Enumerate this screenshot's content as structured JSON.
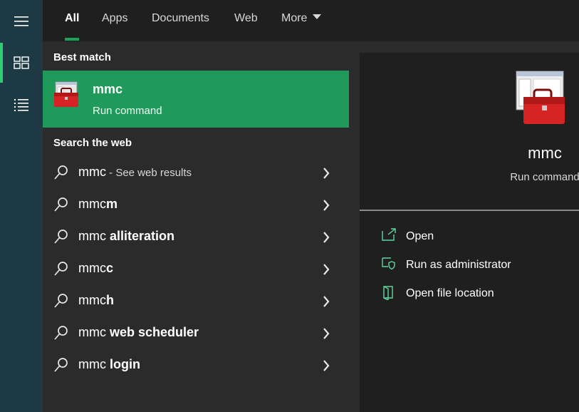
{
  "rail": {
    "items": [
      {
        "icon": "hamburger-icon"
      },
      {
        "icon": "home-tiles-icon",
        "active": true
      },
      {
        "icon": "list-icon"
      }
    ]
  },
  "tabs": [
    {
      "label": "All",
      "active": true
    },
    {
      "label": "Apps"
    },
    {
      "label": "Documents"
    },
    {
      "label": "Web"
    },
    {
      "label": "More"
    }
  ],
  "results": {
    "best_match_title": "Best match",
    "best": {
      "name": "mmc",
      "type": "Run command",
      "icon": "toolbox-icon"
    },
    "web_title": "Search the web",
    "web_items": [
      {
        "prefix": "mmc",
        "bold": "",
        "hint": " - See web results"
      },
      {
        "prefix": "mmc",
        "bold": "m",
        "hint": ""
      },
      {
        "prefix": "mmc ",
        "bold": "alliteration",
        "hint": ""
      },
      {
        "prefix": "mmc",
        "bold": "c",
        "hint": ""
      },
      {
        "prefix": "mmc",
        "bold": "h",
        "hint": ""
      },
      {
        "prefix": "mmc ",
        "bold": "web scheduler",
        "hint": ""
      },
      {
        "prefix": "mmc ",
        "bold": "login",
        "hint": ""
      }
    ]
  },
  "details": {
    "title": "mmc",
    "subtitle": "Run command",
    "actions": [
      {
        "label": "Open",
        "icon": "open-icon"
      },
      {
        "label": "Run as administrator",
        "icon": "shield-icon"
      },
      {
        "label": "Open file location",
        "icon": "file-location-icon"
      }
    ]
  },
  "colors": {
    "accent": "#1f9a5a",
    "rail": "#1d3a44",
    "action_icon": "#5fd6a0"
  }
}
